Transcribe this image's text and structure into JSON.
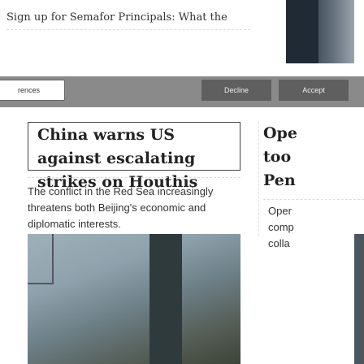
{
  "promo": {
    "text": "Sign up for Semafor Principals: What the"
  },
  "consent": {
    "preferences_label": "rences",
    "decline_label": "Decline",
    "accept_label": "Accept"
  },
  "main_story": {
    "headline": "China warns US against escalating strikes on Houthis",
    "summary": "The conflict in the Red Sea increasingly threatens both Beijing's economic and diplomatic interests."
  },
  "side_story": {
    "headline_lines": [
      "Ope",
      "too",
      "Pen"
    ],
    "summary": "Oper\ncomp\ncolla"
  }
}
